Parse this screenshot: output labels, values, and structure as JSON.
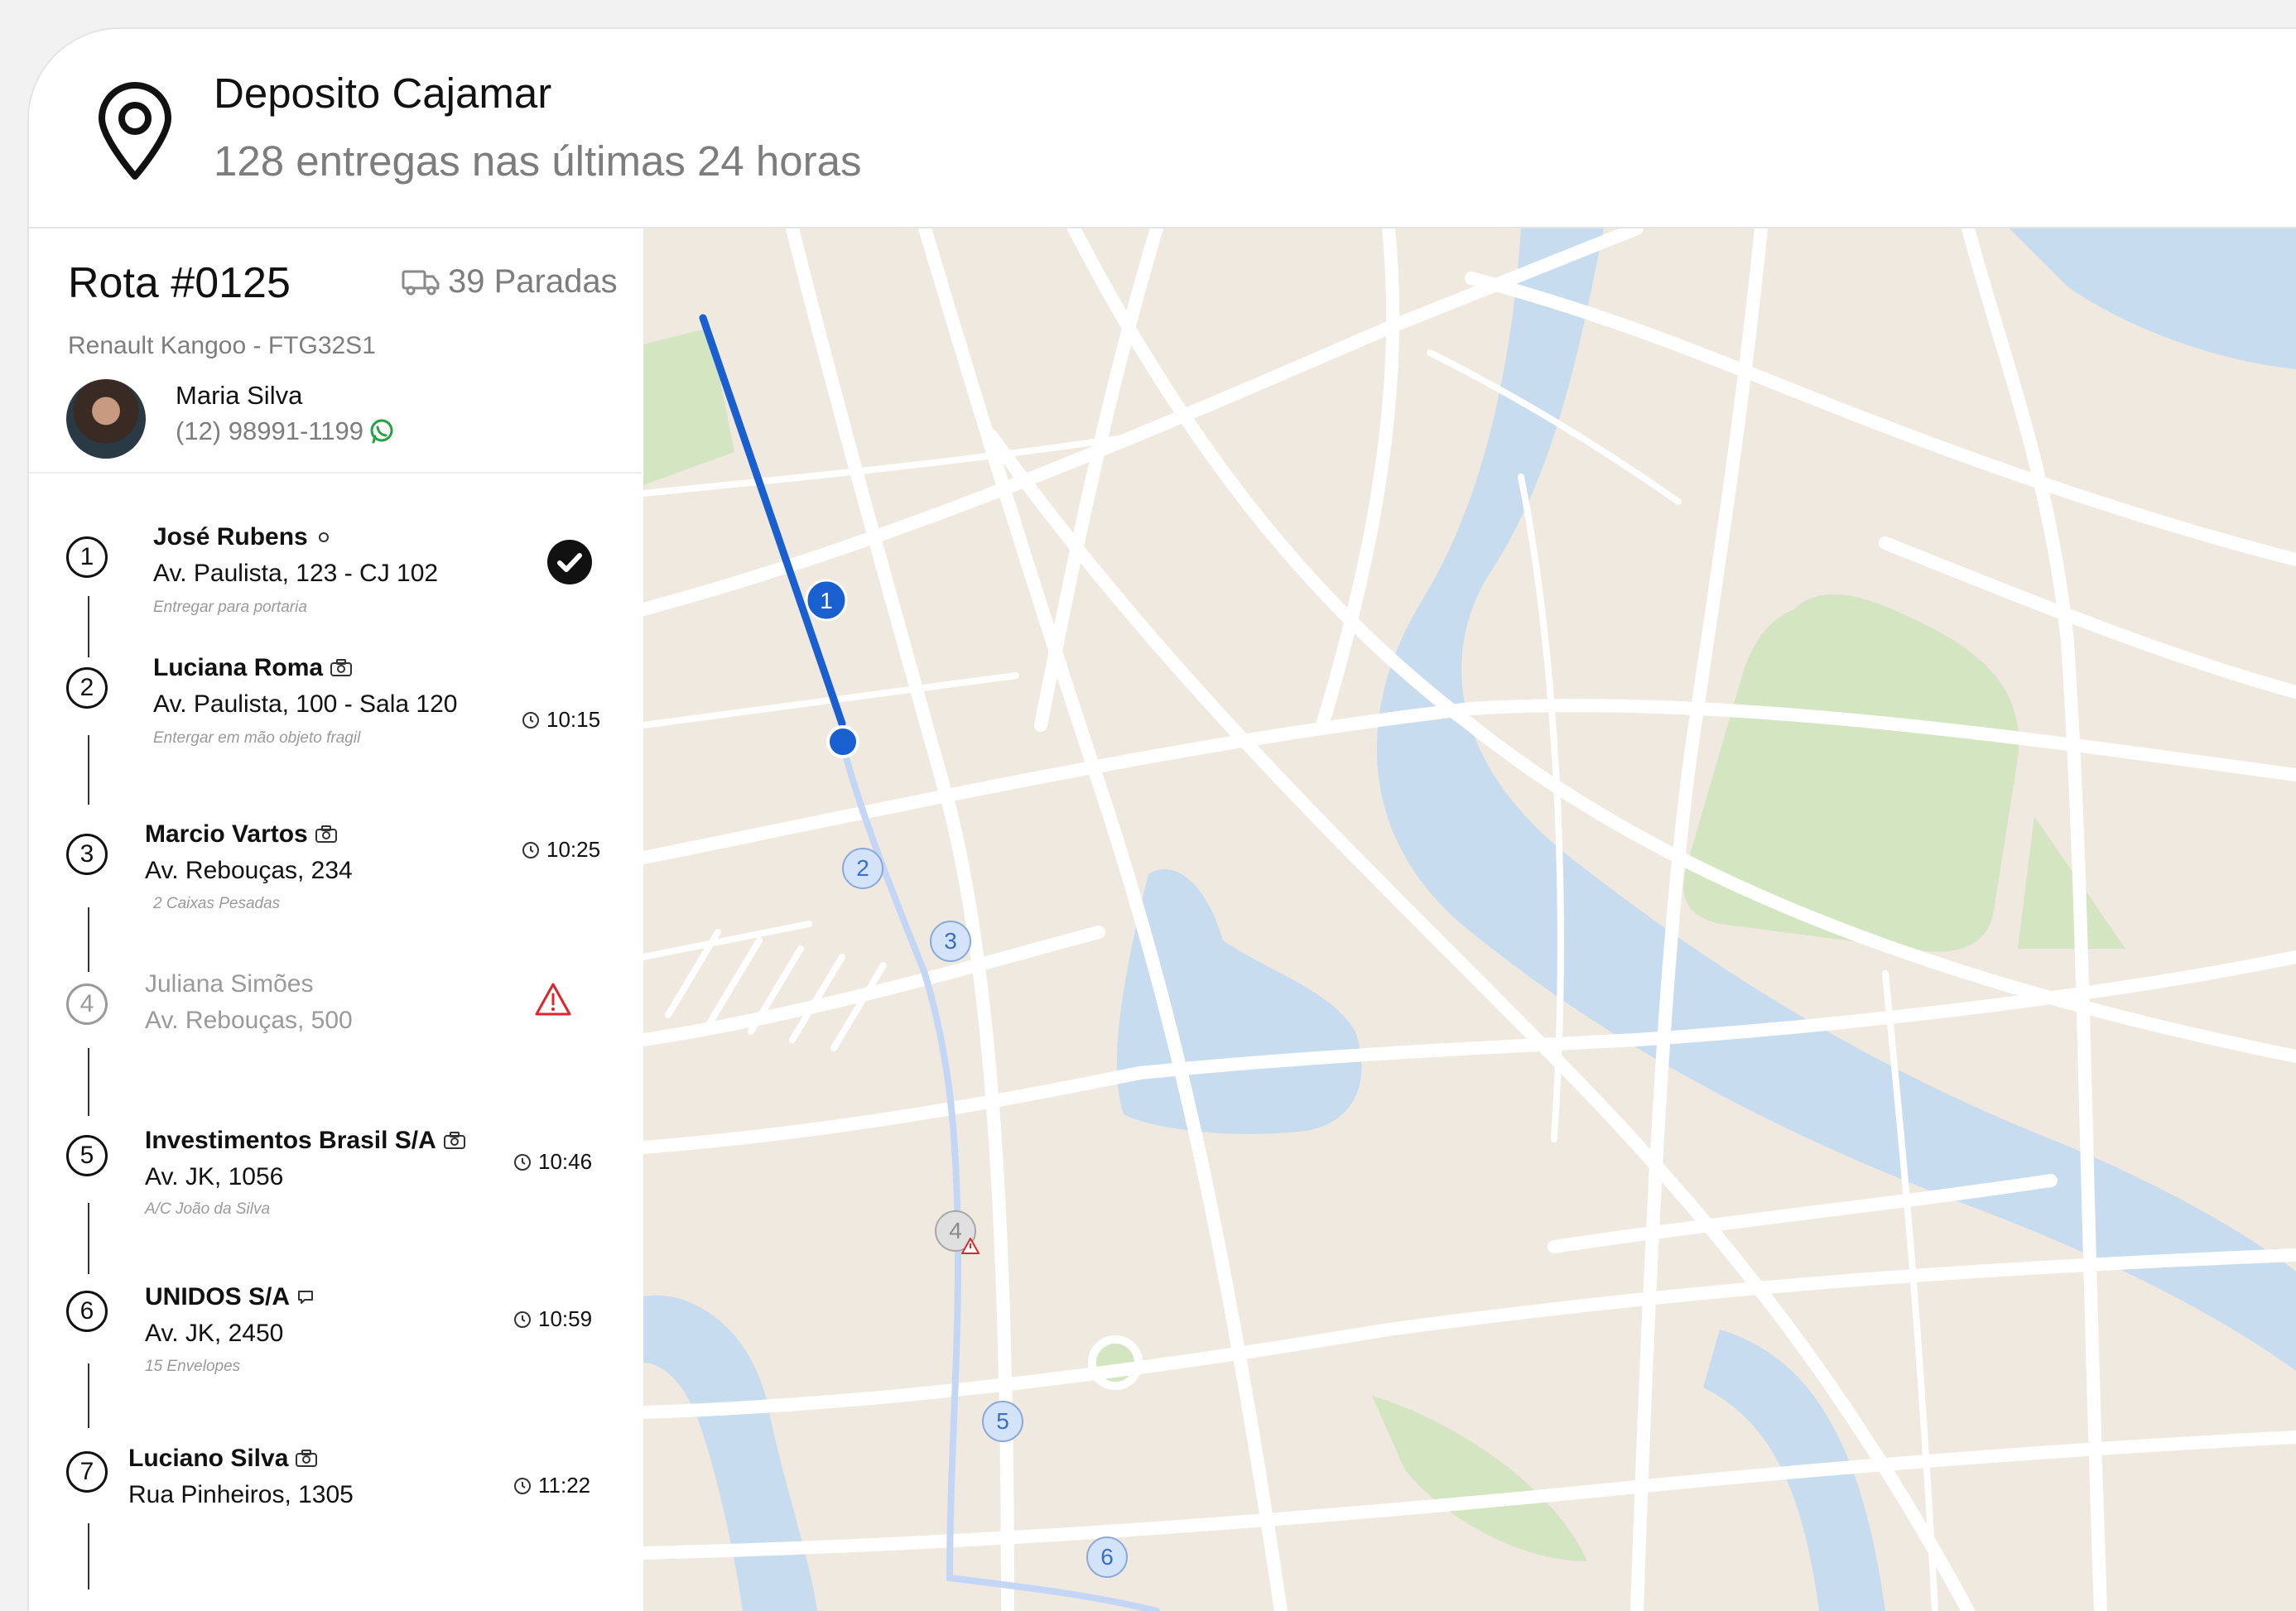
{
  "header": {
    "title": "Deposito Cajamar",
    "subtitle": "128 entregas nas últimas 24 horas",
    "icon": "map-pin-icon"
  },
  "route": {
    "title": "Rota #0125",
    "vehicle": "Renault Kangoo - FTG32S1",
    "stops_count": "39 Paradas",
    "driver": {
      "name": "Maria Silva",
      "phone": "(12) 98991-1199"
    }
  },
  "stops": [
    {
      "number": "1",
      "name": "José Rubens",
      "address": "Av. Paulista, 123 - CJ 102",
      "note": "Entregar para portaria",
      "status": "delivered"
    },
    {
      "number": "2",
      "name": "Luciana Roma",
      "address": "Av. Paulista, 100 - Sala 120",
      "note": "Entergar em mão objeto fragil",
      "time": "10:15"
    },
    {
      "number": "3",
      "name": "Marcio Vartos",
      "address": "Av. Rebouças, 234",
      "note": "2 Caixas Pesadas",
      "time": "10:25"
    },
    {
      "number": "4",
      "name": "Juliana Simões",
      "address": "Av. Rebouças, 500",
      "status": "alert"
    },
    {
      "number": "5",
      "name": "Investimentos Brasil S/A",
      "address": "Av. JK, 1056",
      "note": "A/C João da Silva",
      "time": "10:46"
    },
    {
      "number": "6",
      "name": "UNIDOS S/A",
      "address": "Av. JK, 2450",
      "note": "15 Envelopes",
      "time": "10:59"
    },
    {
      "number": "7",
      "name": "Luciano Silva",
      "address": "Rua Pinheiros, 1305",
      "time": "11:22"
    }
  ],
  "map": {
    "markers": [
      "1",
      "2",
      "3",
      "4",
      "5",
      "6"
    ],
    "colors": {
      "land": "#f0e9df",
      "water": "#c8dcef",
      "park": "#d3e6c1",
      "route_done": "#1a5fd0",
      "route_planned": "#c4d6f6"
    }
  }
}
